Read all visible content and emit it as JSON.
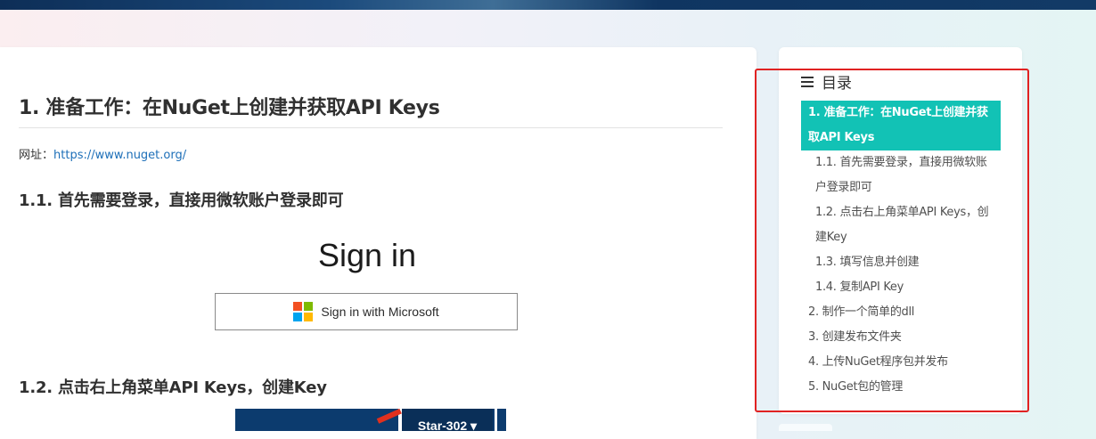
{
  "article": {
    "h1": "1. 准备工作：在NuGet上创建并获取API Keys",
    "site_label": "网址：",
    "site_url": "https://www.nuget.org/",
    "h2_login": "1.1. 首先需要登录，直接用微软账户登录即可",
    "signin_title": "Sign in",
    "ms_button_label": "Sign in with Microsoft",
    "h2_menu": "1.2. 点击右上角菜单API Keys，创建Key",
    "strip_button_label": "Star-302 ▾"
  },
  "ms_logo_colors": [
    "#f25022",
    "#7fba00",
    "#00a4ef",
    "#ffb900"
  ],
  "toc": {
    "title": "目录",
    "icon": "menu-icon",
    "accent": "#12c2b5",
    "items": [
      {
        "label": "1. 准备工作：在NuGet上创建并获",
        "level": 1,
        "active": true
      },
      {
        "label": "取API Keys",
        "level": 1,
        "active": true
      },
      {
        "label": "1.1. 首先需要登录，直接用微软账",
        "level": 2,
        "active": false
      },
      {
        "label": "户登录即可",
        "level": 2,
        "active": false
      },
      {
        "label": "1.2. 点击右上角菜单API Keys，创",
        "level": 2,
        "active": false
      },
      {
        "label": "建Key",
        "level": 2,
        "active": false
      },
      {
        "label": "1.3. 填写信息并创建",
        "level": 2,
        "active": false
      },
      {
        "label": "1.4. 复制API Key",
        "level": 2,
        "active": false
      },
      {
        "label": "2. 制作一个简单的dll",
        "level": 1,
        "active": false
      },
      {
        "label": "3. 创建发布文件夹",
        "level": 1,
        "active": false
      },
      {
        "label": "4. 上传NuGet程序包并发布",
        "level": 1,
        "active": false
      },
      {
        "label": "5. NuGet包的管理",
        "level": 1,
        "active": false
      }
    ]
  }
}
